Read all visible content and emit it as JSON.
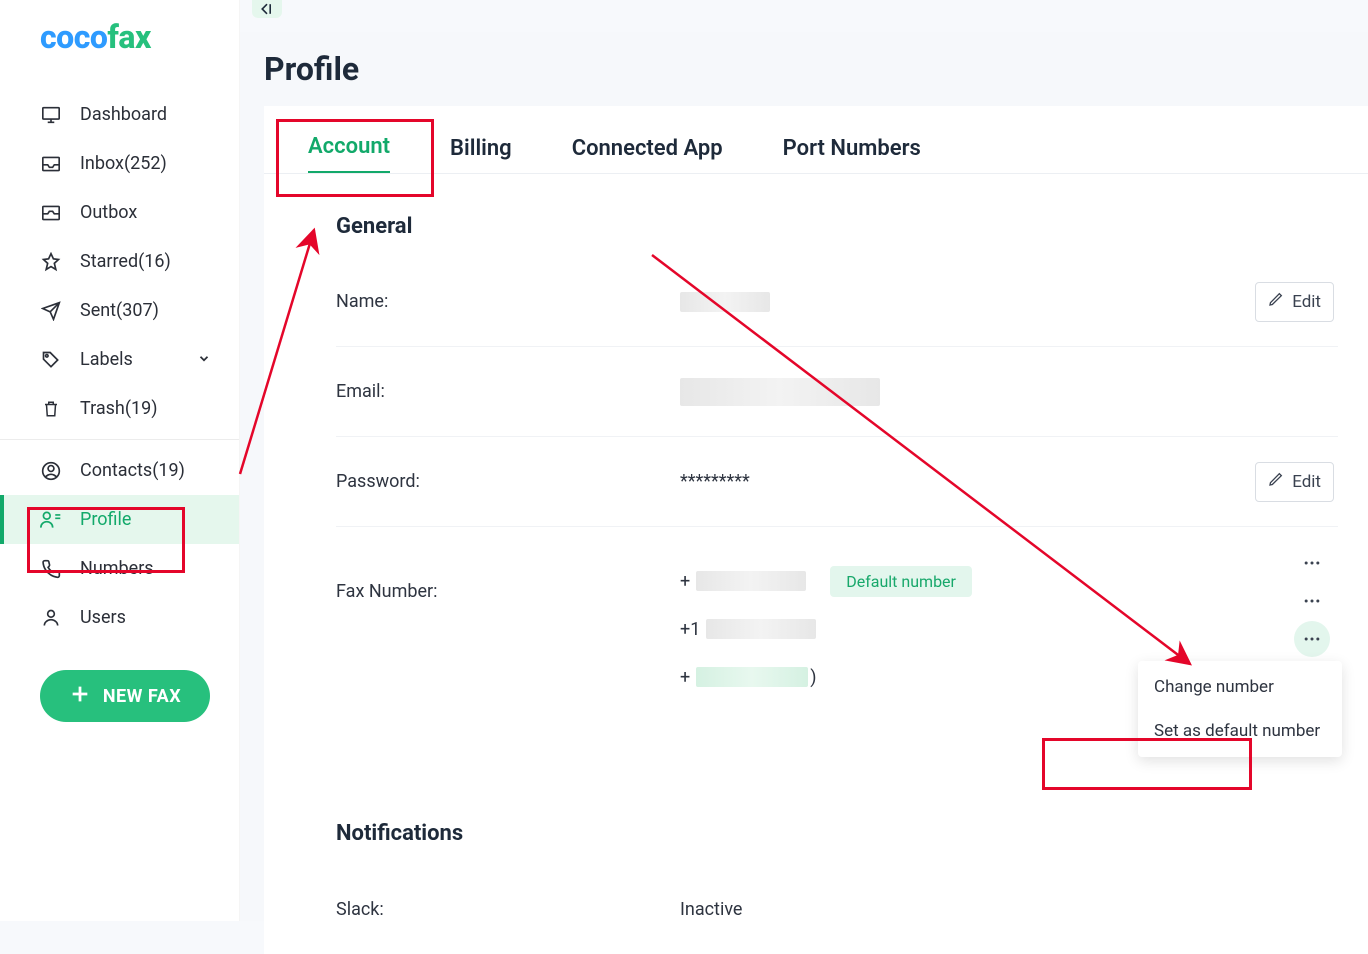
{
  "brand": {
    "part1": "coco",
    "part2": "fax"
  },
  "sidebar": {
    "items": [
      {
        "label": "Dashboard"
      },
      {
        "label": "Inbox(252)"
      },
      {
        "label": "Outbox"
      },
      {
        "label": "Starred(16)"
      },
      {
        "label": "Sent(307)"
      },
      {
        "label": "Labels"
      },
      {
        "label": "Trash(19)"
      },
      {
        "label": "Contacts(19)"
      },
      {
        "label": "Profile"
      },
      {
        "label": "Numbers"
      },
      {
        "label": "Users"
      }
    ],
    "new_fax": "NEW FAX"
  },
  "page": {
    "title": "Profile"
  },
  "tabs": [
    {
      "label": "Account"
    },
    {
      "label": "Billing"
    },
    {
      "label": "Connected App"
    },
    {
      "label": "Port Numbers"
    }
  ],
  "general": {
    "heading": "General",
    "name_label": "Name:",
    "email_label": "Email:",
    "password_label": "Password:",
    "password_value": "*********",
    "fax_label": "Fax Number:",
    "edit": "Edit",
    "default_badge": "Default number",
    "fax_prefix_1": "+",
    "fax_prefix_2": "+1",
    "fax_prefix_3": "+",
    "fax_suffix_3": ")"
  },
  "popup": {
    "change": "Change number",
    "set_default": "Set as default number"
  },
  "notifications": {
    "heading": "Notifications",
    "slack_label": "Slack:",
    "slack_value": "Inactive"
  }
}
